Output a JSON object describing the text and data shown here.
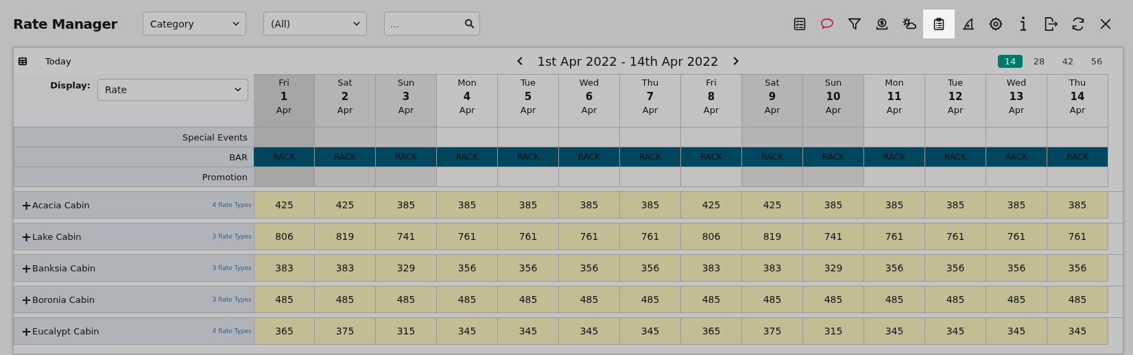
{
  "title": "Rate Manager",
  "filters": [
    {
      "kind": "select",
      "value": "Category"
    },
    {
      "kind": "select",
      "value": "(All)"
    },
    {
      "kind": "search",
      "placeholder": "..."
    }
  ],
  "toolbar": [
    {
      "kind": "checklist",
      "selected": false
    },
    {
      "kind": "chat",
      "selected": false
    },
    {
      "kind": "filter",
      "selected": false
    },
    {
      "kind": "money",
      "selected": false
    },
    {
      "kind": "weather",
      "selected": false
    },
    {
      "kind": "clipboard",
      "selected": true
    },
    {
      "kind": "hat",
      "selected": false
    },
    {
      "kind": "settings",
      "selected": false
    },
    {
      "kind": "info",
      "selected": false
    },
    {
      "kind": "logout",
      "selected": false
    },
    {
      "kind": "refresh",
      "selected": false
    },
    {
      "kind": "close",
      "selected": false
    }
  ],
  "calendar": {
    "today_label": "Today",
    "range": "1st Apr 2022 - 14th Apr 2022",
    "periods": [
      {
        "label": "14",
        "selected": true
      },
      {
        "label": "28",
        "selected": false
      },
      {
        "label": "42",
        "selected": false
      },
      {
        "label": "56",
        "selected": false
      }
    ]
  },
  "display": {
    "label": "Display:",
    "value": "Rate"
  },
  "days": [
    {
      "weekday": "Fri",
      "day": "1",
      "month": "Apr",
      "kind": "today"
    },
    {
      "weekday": "Sat",
      "day": "2",
      "month": "Apr",
      "kind": "weekend"
    },
    {
      "weekday": "Sun",
      "day": "3",
      "month": "Apr",
      "kind": "weekend"
    },
    {
      "weekday": "Mon",
      "day": "4",
      "month": "Apr",
      "kind": "weekday"
    },
    {
      "weekday": "Tue",
      "day": "5",
      "month": "Apr",
      "kind": "weekday"
    },
    {
      "weekday": "Wed",
      "day": "6",
      "month": "Apr",
      "kind": "weekday"
    },
    {
      "weekday": "Thu",
      "day": "7",
      "month": "Apr",
      "kind": "weekday"
    },
    {
      "weekday": "Fri",
      "day": "8",
      "month": "Apr",
      "kind": "weekday"
    },
    {
      "weekday": "Sat",
      "day": "9",
      "month": "Apr",
      "kind": "weekend"
    },
    {
      "weekday": "Sun",
      "day": "10",
      "month": "Apr",
      "kind": "weekend"
    },
    {
      "weekday": "Mon",
      "day": "11",
      "month": "Apr",
      "kind": "weekday"
    },
    {
      "weekday": "Tue",
      "day": "12",
      "month": "Apr",
      "kind": "weekday"
    },
    {
      "weekday": "Wed",
      "day": "13",
      "month": "Apr",
      "kind": "weekday"
    },
    {
      "weekday": "Thu",
      "day": "14",
      "month": "Apr",
      "kind": "weekday"
    }
  ],
  "summary_rows": [
    {
      "label": "Special Events",
      "kind": "empty"
    },
    {
      "label": "BAR",
      "kind": "rate",
      "cells": [
        "RACK",
        "RACK",
        "RACK",
        "RACK",
        "RACK",
        "RACK",
        "RACK",
        "RACK",
        "RACK",
        "RACK",
        "RACK",
        "RACK",
        "RACK",
        "RACK"
      ]
    },
    {
      "label": "Promotion",
      "kind": "empty"
    }
  ],
  "rooms": [
    {
      "toggle": "+",
      "name": "Acacia Cabin",
      "rate_types": "4 Rate Types",
      "rates": [
        "425",
        "425",
        "385",
        "385",
        "385",
        "385",
        "385",
        "425",
        "425",
        "385",
        "385",
        "385",
        "385",
        "385"
      ]
    },
    {
      "toggle": "+",
      "name": "Lake Cabin",
      "rate_types": "3 Rate Types",
      "rates": [
        "806",
        "819",
        "741",
        "761",
        "761",
        "761",
        "761",
        "806",
        "819",
        "741",
        "761",
        "761",
        "761",
        "761"
      ]
    },
    {
      "toggle": "+",
      "name": "Banksia Cabin",
      "rate_types": "3 Rate Types",
      "rates": [
        "383",
        "383",
        "329",
        "356",
        "356",
        "356",
        "356",
        "383",
        "383",
        "329",
        "356",
        "356",
        "356",
        "356"
      ]
    },
    {
      "toggle": "+",
      "name": "Boronia Cabin",
      "rate_types": "3 Rate Types",
      "rates": [
        "485",
        "485",
        "485",
        "485",
        "485",
        "485",
        "485",
        "485",
        "485",
        "485",
        "485",
        "485",
        "485",
        "485"
      ]
    },
    {
      "toggle": "+",
      "name": "Eucalypt Cabin",
      "rate_types": "4 Rate Types",
      "rates": [
        "365",
        "375",
        "315",
        "345",
        "345",
        "345",
        "345",
        "365",
        "375",
        "315",
        "345",
        "345",
        "345",
        "345"
      ]
    }
  ]
}
